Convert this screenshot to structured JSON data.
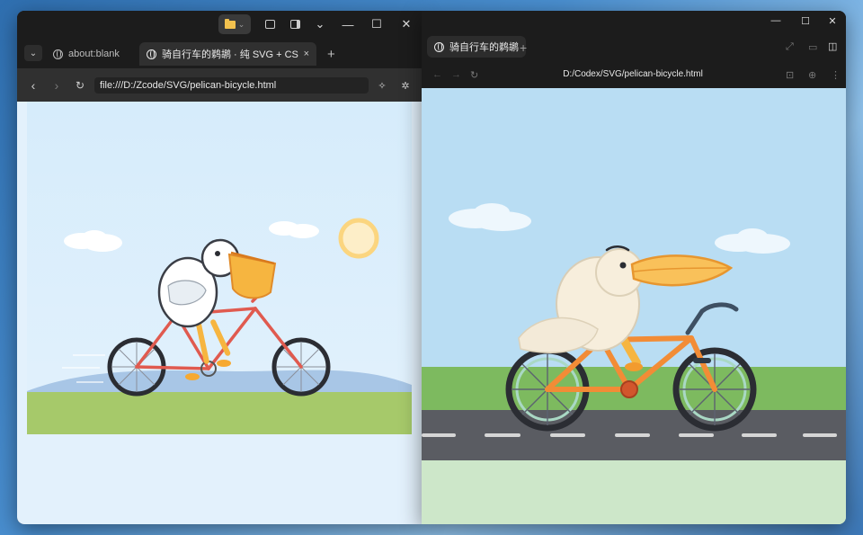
{
  "left_window": {
    "tabs": [
      {
        "label": "about:blank",
        "active": false
      },
      {
        "label": "骑自行车的鹈鹕 · 纯 SVG + CSS 动画",
        "active": true
      }
    ],
    "new_tab_label": "+",
    "close_tab_label": "×",
    "address": "file:///D:/Zcode/SVG/pelican-bicycle.html",
    "window_controls": {
      "minimize": "—",
      "maximize": "☐",
      "close": "✕",
      "dropdown": "⌄"
    }
  },
  "right_window": {
    "tabs": [
      {
        "label": "骑自行车的鹈鹕",
        "active": true
      }
    ],
    "new_tab_label": "+",
    "address": "D:/Codex/SVG/pelican-bicycle.html",
    "window_controls": {
      "minimize": "—",
      "maximize": "☐",
      "close": "✕"
    }
  },
  "colors": {
    "sky_left": "#d6ecfb",
    "grass_left": "#a6c96a",
    "hill_left": "#a8c6e6",
    "sun": "#fbe3a5",
    "sky_right": "#b9ddf3",
    "grass_right": "#7dba5f",
    "road": "#5a5c62",
    "frame_left": "#e05a4f",
    "frame_right": "#f28c36",
    "beak": "#f6b540",
    "tire": "#2b2d33"
  },
  "icons": [
    "folder-icon",
    "terminal-icon",
    "sidebar-icon",
    "globe-icon",
    "back-icon",
    "forward-icon",
    "reload-icon",
    "cursor-sparkle-icon",
    "bug-icon"
  ]
}
